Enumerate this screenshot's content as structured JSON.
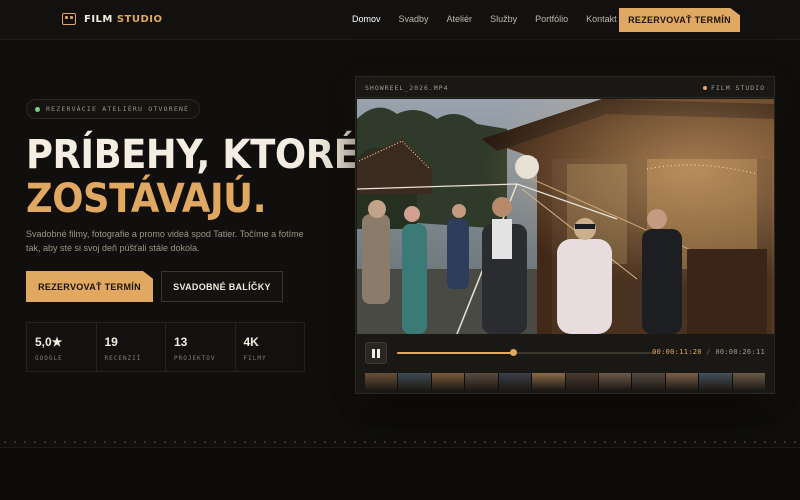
{
  "nav": {
    "logo_film": "FILM",
    "logo_studio": "STUDIO",
    "links": [
      "Domov",
      "Svadby",
      "Ateliér",
      "Služby",
      "Portfólio",
      "Kontakt"
    ],
    "cta": "REZERVOVAŤ TERMÍN"
  },
  "hero": {
    "badge": "REZERVÁCIE ATELIÉRU OTVORENÉ",
    "headline_1": "PRÍBEHY, KTORÉ",
    "headline_2": "ZOSTÁVAJÚ.",
    "lead": "Svadobné filmy, fotografie a promo videá spod Tatier. Točíme a fotíme tak, aby ste si svoj deň púšťali stále dokola.",
    "primary_button": "REZERVOVAŤ TERMÍN",
    "secondary_button": "SVADOBNÉ BALÍČKY",
    "stats": [
      {
        "value": "5,0★",
        "label": "GOOGLE"
      },
      {
        "value": "19",
        "label": "RECENZIÍ"
      },
      {
        "value": "13",
        "label": "PROJEKTOV"
      },
      {
        "value": "4K",
        "label": "FILMY"
      }
    ]
  },
  "player": {
    "file_name": "SHOWREEL_2026.MP4",
    "brand": "FILM STUDIO",
    "time_current": "00:00:11:20",
    "time_separator": "/",
    "time_total": "00:00:26:11",
    "progress": 0.45,
    "accent_color": "#e0a860"
  }
}
